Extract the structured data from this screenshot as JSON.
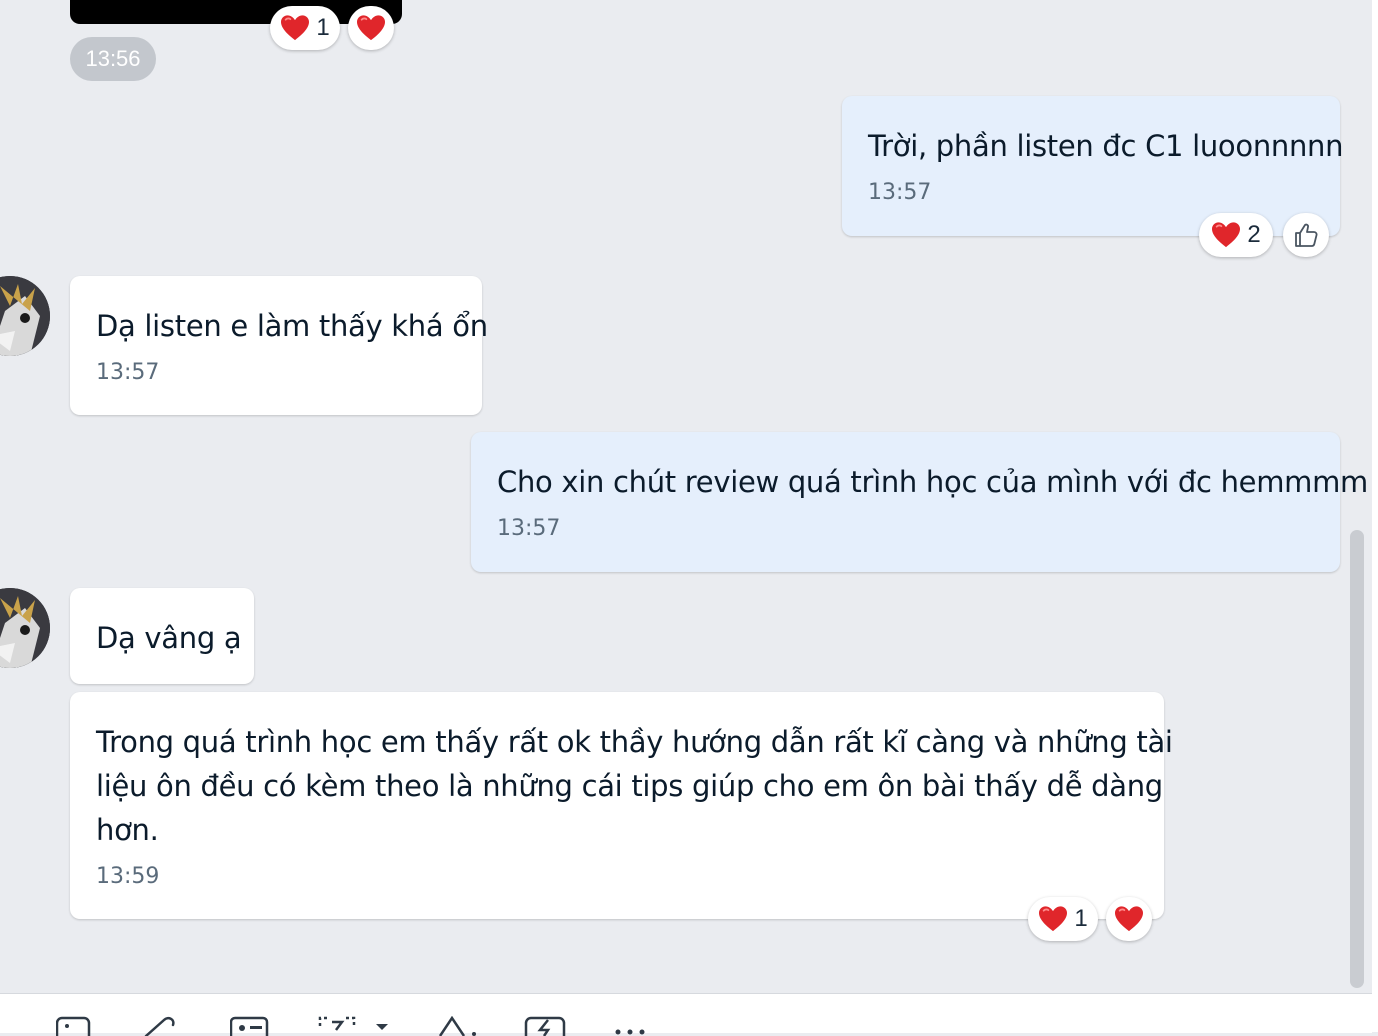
{
  "top_message": {
    "time": "13:56",
    "reactions": [
      {
        "emoji": "heart",
        "count": "1"
      },
      {
        "emoji": "heart",
        "count": ""
      }
    ]
  },
  "messages": [
    {
      "id": "m1",
      "side": "sent",
      "text": "Trời, phần listen đc C1 luoonnnnn",
      "time": "13:57",
      "reactions": [
        {
          "emoji": "heart",
          "count": "2"
        },
        {
          "emoji": "like",
          "count": ""
        }
      ]
    },
    {
      "id": "m2",
      "side": "received",
      "text": "Dạ listen e làm thấy khá ổn",
      "time": "13:57"
    },
    {
      "id": "m3",
      "side": "sent",
      "text": "Cho xin chút review quá trình học của mình với đc hemmmm",
      "time": "13:57"
    },
    {
      "id": "m4",
      "side": "received",
      "text": "Dạ vâng ạ"
    },
    {
      "id": "m5",
      "side": "received",
      "lines": [
        "Trong quá trình học em thấy rất ok thầy hướng dẫn rất kĩ càng và những tài",
        "liệu ôn đều có kèm theo là những cái tips giúp cho em ôn bài thấy dễ dàng",
        "hơn."
      ],
      "time": "13:59",
      "reactions": [
        {
          "emoji": "heart",
          "count": "1"
        },
        {
          "emoji": "heart",
          "count": ""
        }
      ]
    }
  ],
  "colors": {
    "sent_bubble": "#e5effc",
    "received_bubble": "#ffffff",
    "background": "#eaecf0",
    "heart": "#e0262b"
  },
  "toolbar_icons": [
    "sticker-icon",
    "image-icon",
    "attachment-icon",
    "contact-card-icon",
    "screenshot-icon",
    "text-format-icon",
    "quick-message-icon",
    "more-icon"
  ]
}
